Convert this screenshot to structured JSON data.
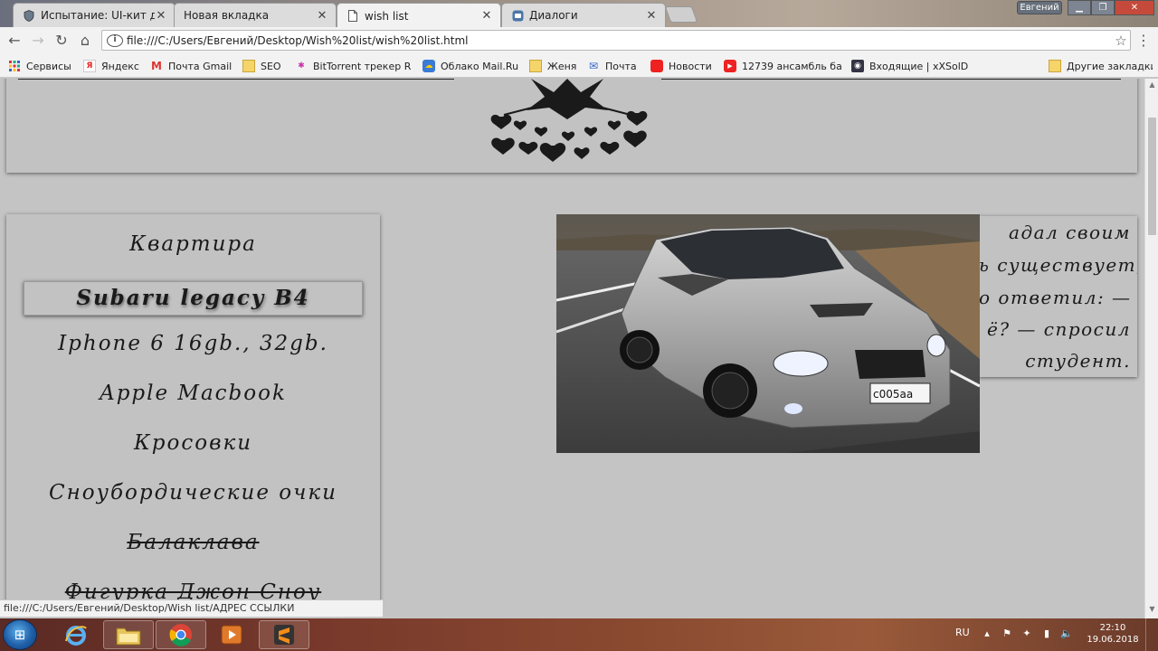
{
  "browser": {
    "tabs": [
      {
        "label": "Испытание: UI-кит для с",
        "icon": "shield-icon"
      },
      {
        "label": "Новая вкладка",
        "icon": "blank-page-icon"
      },
      {
        "label": "wish list",
        "icon": "document-icon"
      },
      {
        "label": "Диалоги",
        "icon": "vk-icon"
      }
    ],
    "user_badge": "Евгений",
    "address": "file:///C:/Users/Евгений/Desktop/Wish%20list/wish%20list.html",
    "bookmarks": [
      {
        "label": "Сервисы",
        "icon": "apps-grid-icon"
      },
      {
        "label": "Яндекс",
        "icon": "yandex-icon"
      },
      {
        "label": "Почта Gmail",
        "icon": "gmail-icon"
      },
      {
        "label": "SEO",
        "icon": "folder-icon"
      },
      {
        "label": "BitTorrent трекер Ru",
        "icon": "bittorrent-icon"
      },
      {
        "label": "Облако Mail.Ru",
        "icon": "cloud-icon"
      },
      {
        "label": "Женя",
        "icon": "folder-icon"
      },
      {
        "label": "Почта",
        "icon": "mail-icon"
      },
      {
        "label": "Новости",
        "icon": "news-icon"
      },
      {
        "label": "12739 ансамбль ба",
        "icon": "youtube-icon"
      },
      {
        "label": "Входящие | xXSolDie",
        "icon": "inbox-icon"
      },
      {
        "label": "Другие закладки",
        "icon": "folder-icon"
      }
    ]
  },
  "wish_list": {
    "items": [
      {
        "label": "Квартира",
        "state": "normal"
      },
      {
        "label": "Subaru legacy B4",
        "state": "highlighted"
      },
      {
        "label": "Iphone 6 16gb., 32gb.",
        "state": "normal"
      },
      {
        "label": "Apple Macbook",
        "state": "normal"
      },
      {
        "label": "Кросовки",
        "state": "normal"
      },
      {
        "label": "Сноубордические очки",
        "state": "normal"
      },
      {
        "label": "Балаклава",
        "state": "done"
      },
      {
        "label": "Фигурка Джон Сноу",
        "state": "done"
      }
    ]
  },
  "quote": {
    "lines": [
      "адал своим",
      "ь существует,",
      "о ответил: —",
      "ё? — спросил",
      "студент."
    ]
  },
  "status_bar": {
    "text": "file:///C:/Users/Евгений/Desktop/Wish list/АДРЕС ССЫЛКИ"
  },
  "taskbar": {
    "lang": "RU",
    "time": "22:10",
    "date": "19.06.2018",
    "apps": [
      "internet-explorer-icon",
      "file-explorer-icon",
      "chrome-icon",
      "media-player-icon",
      "sublime-text-icon"
    ]
  },
  "colors": {
    "page_background": "#c4c4c4",
    "tab_active": "#f2f2f2",
    "window_close": "#c64a3c"
  }
}
